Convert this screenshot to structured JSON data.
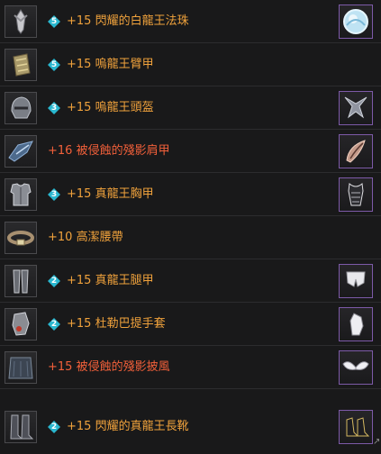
{
  "colors": {
    "background": "#19191a",
    "name_orange": "#f0a23c",
    "name_red": "#f2603a",
    "gem_cyan": "#29b7cf",
    "slot_border_purple": "#7d5aa8"
  },
  "items": [
    {
      "name": "+15 閃耀的白龍王法珠",
      "gem": "5",
      "icon": "necklace-icon",
      "appearance_icon": "orb-icon"
    },
    {
      "name": "+15 嗚龍王臂甲",
      "gem": "5",
      "icon": "bracer-icon",
      "appearance_icon": ""
    },
    {
      "name": "+15 嗚龍王頭盔",
      "gem": "3",
      "icon": "helmet-icon",
      "appearance_icon": "horned-helmet-icon"
    },
    {
      "name": "+16 被侵蝕的殘影肩甲",
      "gem": "",
      "icon": "shoulder-armor-icon",
      "appearance_icon": "feather-shoulder-icon"
    },
    {
      "name": "+15 真龍王胸甲",
      "gem": "3",
      "icon": "chest-armor-icon",
      "appearance_icon": "corset-icon"
    },
    {
      "name": "+10 高潔腰帶",
      "gem": "",
      "icon": "belt-icon",
      "appearance_icon": ""
    },
    {
      "name": "+15 真龍王腿甲",
      "gem": "2",
      "icon": "leg-armor-icon",
      "appearance_icon": "shorts-icon"
    },
    {
      "name": "+15 杜勒巴提手套",
      "gem": "2",
      "icon": "gauntlet-icon",
      "appearance_icon": "glove-icon"
    },
    {
      "name": "+15 被侵蝕的殘影披風",
      "gem": "",
      "icon": "cloak-icon",
      "appearance_icon": "wings-icon"
    },
    {
      "name": "+15 閃耀的真龍王長靴",
      "gem": "2",
      "icon": "boots-icon",
      "appearance_icon": "heels-icon"
    }
  ],
  "corner_text": "↗"
}
